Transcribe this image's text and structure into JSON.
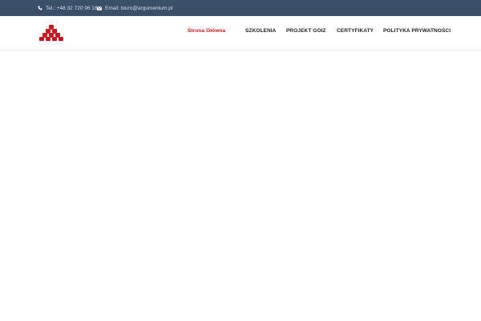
{
  "topbar": {
    "phone_text": "Tel.: +48 32 720 96 18",
    "email_text": "Email: biuro@argumentum.pl"
  },
  "colors": {
    "topbar_bg": "#3a4f68",
    "accent": "#c4161c",
    "nav_text": "#222222"
  },
  "icons": {
    "phone": "phone-icon",
    "email": "envelope-icon",
    "logo": "puzzle-pyramid-logo"
  },
  "nav": {
    "items": [
      {
        "label": "Strona Główna",
        "active": true
      },
      {
        "label": "SZKOLENIA",
        "active": false
      },
      {
        "label": "PROJEKT GOIZ",
        "active": false
      },
      {
        "label": "CERTYFIKATY",
        "active": false
      },
      {
        "label": "POLITYKA PRYWATNOŚCI",
        "active": false
      }
    ]
  }
}
